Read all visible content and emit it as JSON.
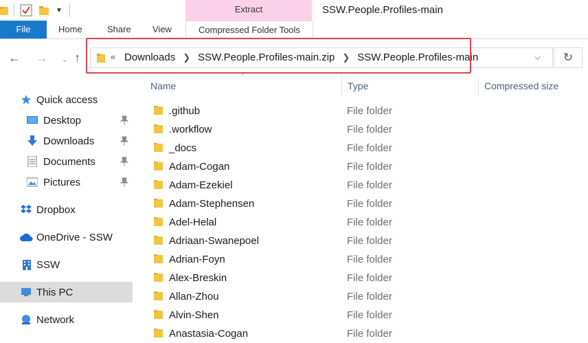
{
  "window": {
    "title": "SSW.People.Profiles-main",
    "contextual_group": "Extract"
  },
  "ribbon": {
    "tabs": [
      "File",
      "Home",
      "Share",
      "View",
      "Compressed Folder Tools"
    ],
    "file_color": "#1979ca",
    "contextual_color": "#fbd1e9"
  },
  "address": {
    "overflow": "«",
    "crumbs": [
      "Downloads",
      "SSW.People.Profiles-main.zip",
      "SSW.People.Profiles-main"
    ],
    "highlight_color": "#e2424d"
  },
  "columns": {
    "name": "Name",
    "type": "Type",
    "size": "Compressed size"
  },
  "sidebar": {
    "items": [
      {
        "label": "Quick access",
        "icon": "star-icon"
      },
      {
        "label": "Desktop",
        "icon": "desktop-icon",
        "pinned": true
      },
      {
        "label": "Downloads",
        "icon": "download-arrow-icon",
        "pinned": true
      },
      {
        "label": "Documents",
        "icon": "documents-icon",
        "pinned": true
      },
      {
        "label": "Pictures",
        "icon": "pictures-icon",
        "pinned": true
      },
      {
        "label": "Dropbox",
        "icon": "dropbox-icon"
      },
      {
        "label": "OneDrive - SSW",
        "icon": "cloud-icon"
      },
      {
        "label": "SSW",
        "icon": "building-icon"
      },
      {
        "label": "This PC",
        "icon": "computer-icon",
        "selected": true
      },
      {
        "label": "Network",
        "icon": "network-icon"
      }
    ]
  },
  "files": [
    {
      "name": ".github",
      "type": "File folder"
    },
    {
      "name": ".workflow",
      "type": "File folder"
    },
    {
      "name": "_docs",
      "type": "File folder"
    },
    {
      "name": "Adam-Cogan",
      "type": "File folder"
    },
    {
      "name": "Adam-Ezekiel",
      "type": "File folder"
    },
    {
      "name": "Adam-Stephensen",
      "type": "File folder"
    },
    {
      "name": "Adel-Helal",
      "type": "File folder"
    },
    {
      "name": "Adriaan-Swanepoel",
      "type": "File folder"
    },
    {
      "name": "Adrian-Foyn",
      "type": "File folder"
    },
    {
      "name": "Alex-Breskin",
      "type": "File folder"
    },
    {
      "name": "Allan-Zhou",
      "type": "File folder"
    },
    {
      "name": "Alvin-Shen",
      "type": "File folder"
    },
    {
      "name": "Anastasia-Cogan",
      "type": "File folder"
    }
  ]
}
